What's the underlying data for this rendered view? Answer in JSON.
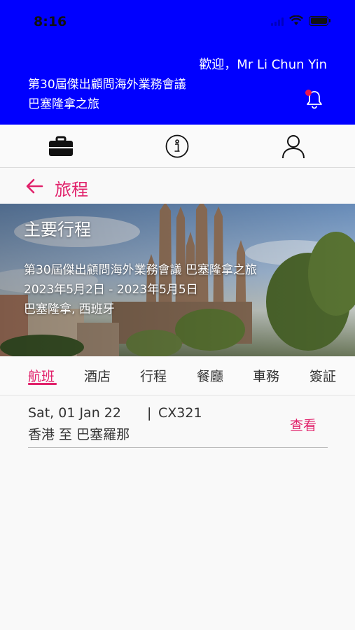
{
  "status_bar": {
    "time": "8:16"
  },
  "header": {
    "welcome": "歡迎，Mr Li Chun Yin",
    "event_line1": "第30屆傑出顧問海外業務會議",
    "event_line2": "巴塞隆拿之旅"
  },
  "tabbar": {
    "items": [
      {
        "icon": "briefcase-icon"
      },
      {
        "icon": "info-icon"
      },
      {
        "icon": "user-icon"
      }
    ]
  },
  "nav": {
    "title": "旅程"
  },
  "hero": {
    "heading": "主要行程",
    "event": "第30屆傑出顧問海外業務會議 巴塞隆拿之旅",
    "dates": "2023年5月2日 - 2023年5月5日",
    "location": "巴塞隆拿, 西班牙"
  },
  "categories": [
    "航班",
    "酒店",
    "行程",
    "餐廳",
    "車務",
    "簽証"
  ],
  "active_category": "航班",
  "flights": [
    {
      "date": "Sat, 01 Jan 22",
      "separator": "|",
      "flight_no": "CX321",
      "route": "香港 至 巴塞羅那",
      "action": "查看"
    }
  ],
  "colors": {
    "header_bg": "#0000ff",
    "accent": "#e1226b",
    "notification_dot": "#e8174f"
  }
}
